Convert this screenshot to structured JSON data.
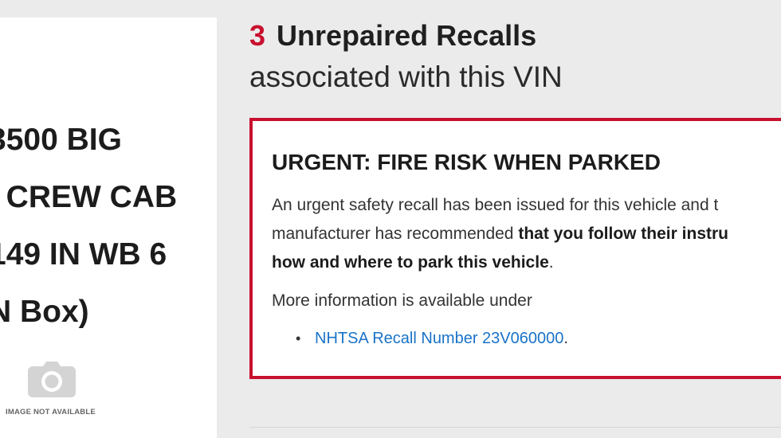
{
  "vehicle": {
    "name_lines": [
      "3500 BIG",
      "I CREW CAB",
      "149 IN WB 6",
      "N Box)"
    ],
    "image_placeholder_text": "IMAGE NOT AVAILABLE",
    "image_icon": "camera-icon"
  },
  "recalls": {
    "count": "3",
    "heading": "Unrepaired Recalls",
    "subheading": "associated with this VIN",
    "accent_color": "#c8102e",
    "items": [
      {
        "title": "URGENT: FIRE RISK WHEN PARKED",
        "body_start": "An urgent safety recall has been issued for this vehicle and t",
        "body_mid": "manufacturer has recommended ",
        "body_bold": "that you follow their instru",
        "body_bold_2": "how and where to park this vehicle",
        "body_end": ".",
        "more_info": "More information is available under",
        "link_text": "NHTSA Recall Number 23V060000",
        "link_suffix": ".",
        "link_color": "#1a73c8"
      }
    ]
  }
}
